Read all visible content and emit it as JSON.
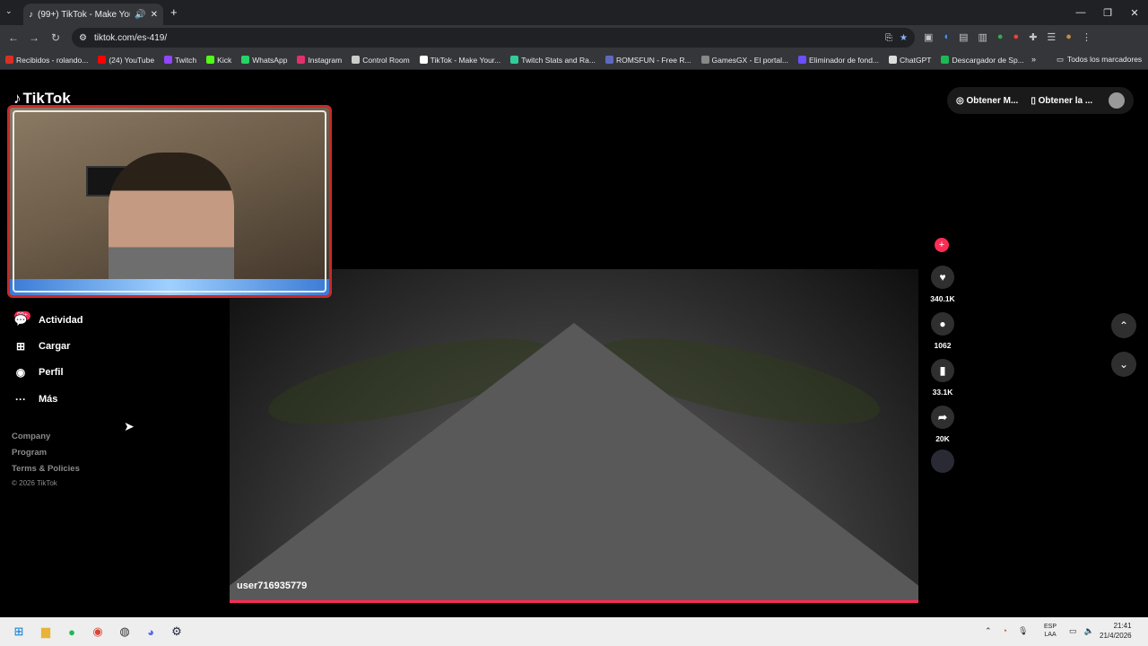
{
  "browser": {
    "tab_title": "(99+) TikTok - Make Your D...",
    "url": "tiktok.com/es-419/"
  },
  "bookmarks": [
    {
      "label": "Recibidos - rolando...",
      "icon": "gmail-icon",
      "color": "#d93025"
    },
    {
      "label": "(24) YouTube",
      "icon": "youtube-icon",
      "color": "#ff0000"
    },
    {
      "label": "Twitch",
      "icon": "twitch-icon",
      "color": "#9146ff"
    },
    {
      "label": "Kick",
      "icon": "kick-icon",
      "color": "#53fc18"
    },
    {
      "label": "WhatsApp",
      "icon": "whatsapp-icon",
      "color": "#25d366"
    },
    {
      "label": "Instagram",
      "icon": "instagram-icon",
      "color": "#e1306c"
    },
    {
      "label": "Control Room",
      "icon": "control-room-icon",
      "color": "#cccccc"
    },
    {
      "label": "TikTok - Make Your...",
      "icon": "tiktok-icon",
      "color": "#ffffff"
    },
    {
      "label": "Twitch Stats and Ra...",
      "icon": "twitchtracker-icon",
      "color": "#33cc99"
    },
    {
      "label": "ROMSFUN - Free R...",
      "icon": "romsfun-icon",
      "color": "#5c6bc0"
    },
    {
      "label": "GamesGX - El portal...",
      "icon": "gamesgx-icon",
      "color": "#888888"
    },
    {
      "label": "Eliminador de fond...",
      "icon": "photoroom-icon",
      "color": "#6b4eff"
    },
    {
      "label": "ChatGPT",
      "icon": "chatgpt-icon",
      "color": "#dddddd"
    },
    {
      "label": "Descargador de Sp...",
      "icon": "download-icon",
      "color": "#1db954"
    }
  ],
  "all_bookmarks": "Todos los marcadores",
  "tiktok": {
    "logo": "TikTok",
    "nav": [
      {
        "label": "Actividad",
        "badge": "99+"
      },
      {
        "label": "Cargar"
      },
      {
        "label": "Perfil"
      },
      {
        "label": "Más"
      }
    ],
    "footer": [
      "Company",
      "Program",
      "Terms & Policies",
      "© 2026 TikTok"
    ],
    "top_buttons": [
      "Obtener M...",
      "Obtener la ..."
    ],
    "video_user": "user716935779",
    "likes": "340.1K",
    "comments": "1062",
    "saves": "33.1K",
    "shares": "20K"
  },
  "taskbar": {
    "lang": "ESP",
    "lang2": "LAA",
    "time": "21:41",
    "date": "21/4/2026"
  }
}
